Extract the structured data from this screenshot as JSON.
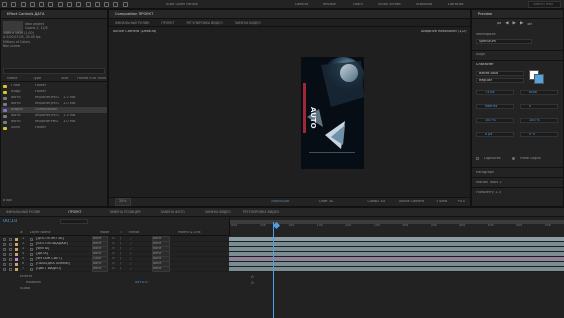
{
  "app": {
    "name": "After Effects"
  },
  "topbar": {
    "snapping_label": "Auto Open Panels",
    "workspaces": [
      "Default",
      "Review",
      "Learn",
      "Small Screen",
      "Standard",
      "Libraries"
    ],
    "active_workspace": "Default",
    "search_placeholder": "Search Help"
  },
  "project_panel": {
    "tab_label": "Effect Controls ДАТА",
    "info_lines": [
      "Ideo project",
      "Сцена 1, 12/5",
      "1080 x 1920 (1.00)",
      "Δ 0;00;07;05, 30.00 fps",
      "Millions of Colors",
      "Non-Linear"
    ],
    "search_placeholder": "",
    "columns": [
      "Name",
      "Type",
      "Size",
      "Frame R...",
      "In Point"
    ],
    "rows": [
      {
        "name": "Глав",
        "type": "Folder",
        "size": "",
        "color": "#d4c62c"
      },
      {
        "name": "Кадр",
        "type": "Folder",
        "size": "",
        "color": "#d4c62c"
      },
      {
        "name": "Фото",
        "type": "ImporterJPEG",
        "size": "1.2 MB",
        "color": "#7a7a7a"
      },
      {
        "name": "Фото",
        "type": "ImporterJPEG",
        "size": "1.0 MB",
        "color": "#7a7a7a"
      },
      {
        "name": "Видео",
        "type": "Composition",
        "size": "",
        "color": "#8f6ec7"
      },
      {
        "name": "Фото",
        "type": "ImporterJPEG",
        "size": "1.3 MB",
        "color": "#7a7a7a"
      },
      {
        "name": "Фото",
        "type": "ImporterPNG",
        "size": "1.0 MB",
        "color": "#7a7a7a"
      },
      {
        "name": "Solid",
        "type": "Folder",
        "size": "",
        "color": "#d4c62c"
      }
    ],
    "bpc": "8 bpc"
  },
  "composition_panel": {
    "tab_label": "Composition ПРОЕКТ",
    "tabs": [
      "ФИНАЛЬНЫЙ РОЛИК",
      "ПРОЕКТ",
      "РЕГУЛИРОВКА ВИДЕО",
      "ЗАМЕНА ВИДЕО"
    ],
    "active_tab": "ПРОЕКТ",
    "camera": "Active Camera (Default)",
    "renderer": "Adaptive Resolution (1/2)",
    "footer": {
      "zoom": "25%",
      "timecode": "0;00;00;00",
      "quality": "Draft 3D",
      "view": "Classic 3D",
      "camera_select": "Active Camera",
      "views": "1 View",
      "offset": "+0.0"
    }
  },
  "right_panel": {
    "preview": "Preview",
    "effects": "Effects & Presets",
    "search_placeholder": "Search Help",
    "library": "Libraries",
    "workspace_label": "Workspace",
    "workspace_value": "Speculum",
    "align": "Align",
    "character": "Character",
    "font_name": "Bebas Bold",
    "font_style": "Regular",
    "size_values": [
      "73 px",
      "Auto",
      "Metrics",
      "0",
      "100 %",
      "100 %",
      "0 px",
      "0 %"
    ],
    "ligatures": "Ligatures",
    "hindi": "Hindi Digits",
    "paragraph": "Paragraph",
    "motion": "Motion Tools 2",
    "flow": "FlowBerry 1.3"
  },
  "timeline": {
    "tabs": [
      "ФИНАЛЬНЫЙ РОЛИК",
      "ПРОЕКТ",
      "ЗАМЕНА ПОЗИЦИЯ",
      "ЗАМЕНА ФОТО",
      "ЗАМЕНА ВИДЕО",
      "РЕГУЛИРОВКА ВИДЕО"
    ],
    "active_tab": "ПРОЕКТ",
    "timecode": "00;10",
    "columns": [
      "#",
      "Layer Name",
      "Mode",
      "T",
      "TrkMat",
      "Parent & Link"
    ],
    "layers": [
      {
        "num": "1",
        "name": "[ДОСТУПНО ЗА]",
        "mode": "None",
        "parent": "None",
        "color": "#c9a56b"
      },
      {
        "num": "2",
        "name": "[БЕЗ ПЛОЩАДКИ]",
        "mode": "None",
        "parent": "None",
        "color": "#c9a56b"
      },
      {
        "num": "3",
        "name": "[ФИТЫ]",
        "mode": "None",
        "parent": "None",
        "color": "#c9a56b"
      },
      {
        "num": "4",
        "name": "[ДАТА]",
        "mode": "None",
        "parent": "None",
        "color": "#c9a56b"
      },
      {
        "num": "5",
        "name": "[ФУТАЖ СВЕТ]",
        "mode": "Color",
        "parent": "None",
        "color": "#b78fd6"
      },
      {
        "num": "6",
        "name": "[ОБВОДКА ЛИНИИ]",
        "mode": "None",
        "parent": "None",
        "color": "#c9a56b"
      },
      {
        "num": "7",
        "name": "[ЦВЕТ ВИДЕО]",
        "mode": "None",
        "parent": "None",
        "color": "#c9a56b"
      }
    ],
    "sub_rows": [
      "Effects",
      "Rotation",
      "Audio"
    ],
    "rotation_value": "0x+0.0°",
    "ruler": [
      "00s",
      "05s",
      "10s",
      "15s",
      "20s",
      "25s",
      "30s",
      "35s",
      "40s",
      "45s",
      "50s",
      "55s"
    ]
  }
}
